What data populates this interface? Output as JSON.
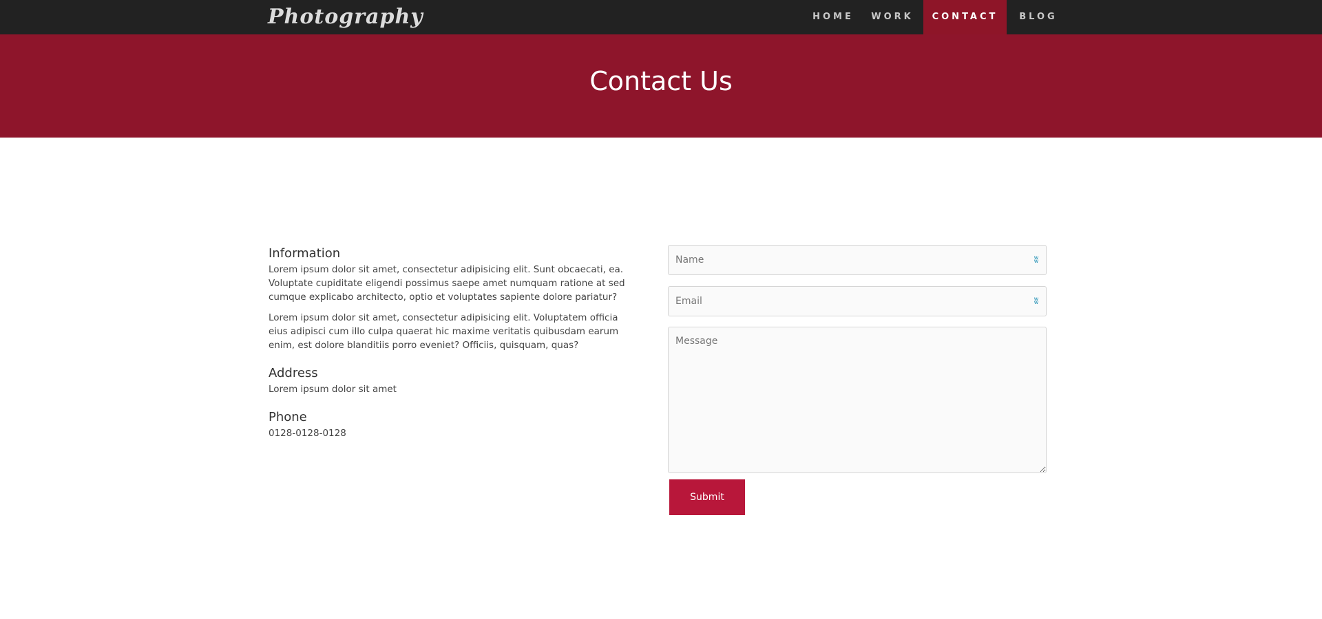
{
  "header": {
    "brand": "Photography",
    "nav": [
      {
        "label": "HOME",
        "active": false
      },
      {
        "label": "WORK",
        "active": false
      },
      {
        "label": "CONTACT",
        "active": true
      },
      {
        "label": "BLOG",
        "active": false
      }
    ]
  },
  "banner": {
    "title": "Contact Us"
  },
  "info": {
    "information_heading": "Information",
    "information_p1": "Lorem ipsum dolor sit amet, consectetur adipisicing elit. Sunt obcaecati, ea. Voluptate cupiditate eligendi possimus saepe amet numquam ratione at sed cumque explicabo architecto, optio et voluptates sapiente dolore pariatur?",
    "information_p2": "Lorem ipsum dolor sit amet, consectetur adipisicing elit. Voluptatem officia eius adipisci cum illo culpa quaerat hic maxime veritatis quibusdam earum enim, est dolore blanditiis porro eveniet? Officiis, quisquam, quas?",
    "address_heading": "Address",
    "address_text": "Lorem ipsum dolor sit amet",
    "phone_heading": "Phone",
    "phone_text": "0128-0128-0128"
  },
  "form": {
    "name_placeholder": "Name",
    "name_value": "",
    "email_placeholder": "Email",
    "email_value": "",
    "message_placeholder": "Message",
    "message_value": "",
    "submit_label": "Submit",
    "autofill_icon": "autofill-key-icon"
  },
  "colors": {
    "navbar": "#222222",
    "banner": "#8e152b",
    "active_nav": "#8e1528",
    "submit": "#b8173a",
    "field_bg": "#fafafa"
  }
}
